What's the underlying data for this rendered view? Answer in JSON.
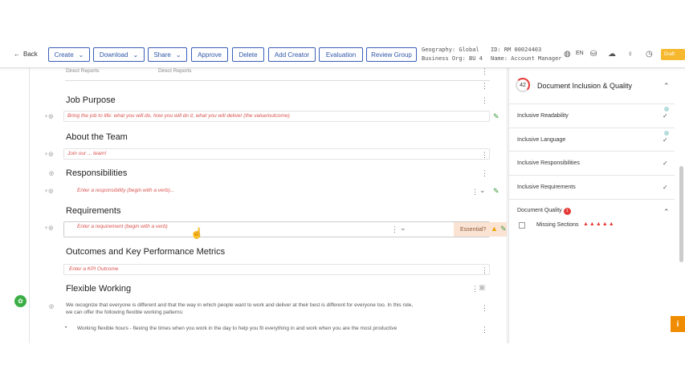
{
  "toolbar": {
    "back_label": "Back",
    "buttons": {
      "create": "Create",
      "download": "Download",
      "share": "Share",
      "approve": "Approve",
      "delete": "Delete",
      "add_creator": "Add Creator",
      "evaluation": "Evaluation",
      "review_group": "Review Group"
    },
    "geography": "Geography: Global",
    "business_org": "Business Org: BU 4",
    "id": "ID: RM 00024403",
    "name": "Name: Account Manager",
    "language": "EN",
    "status": "Draft"
  },
  "document": {
    "direct_reports_label": "Direct Reports",
    "direct_reports_value": "Direct Reports",
    "sections": {
      "job_purpose": {
        "title": "Job Purpose",
        "placeholder": "Bring the job to life: what you will do, how you will do it, what you will deliver (the value/outcome)"
      },
      "about_team": {
        "title": "About the Team",
        "placeholder": "Join our ... team!"
      },
      "responsibilities": {
        "title": "Responsibilities",
        "placeholder": "Enter a responsibility (begin with a verb)..."
      },
      "requirements": {
        "title": "Requirements",
        "placeholder": "Enter a requirement (begin with a verb)",
        "essential_label": "Essential?"
      },
      "outcomes": {
        "title": "Outcomes and Key Performance Metrics",
        "placeholder": "Enter a KPI Outcome"
      },
      "flexible": {
        "title": "Flexible Working",
        "text1": "We recognize that everyone is different and that the way in which people want to work and deliver at their best is different for everyone too. In this role,",
        "text2": "we can offer the following flexible working patterns:",
        "bullet1": "Working flexible hours - flexing the times when you work in the day to help you fit everything in and work when you are the most productive"
      }
    }
  },
  "panel": {
    "score": "42",
    "title": "Document Inclusion & Quality",
    "rows": [
      {
        "label": "Inclusive Readability"
      },
      {
        "label": "Inclusive Language"
      },
      {
        "label": "Inclusive Responsibilities"
      },
      {
        "label": "Inclusive Requirements"
      }
    ],
    "quality_label": "Document Quality",
    "quality_badge": "1",
    "missing_label": "Missing Sections"
  }
}
